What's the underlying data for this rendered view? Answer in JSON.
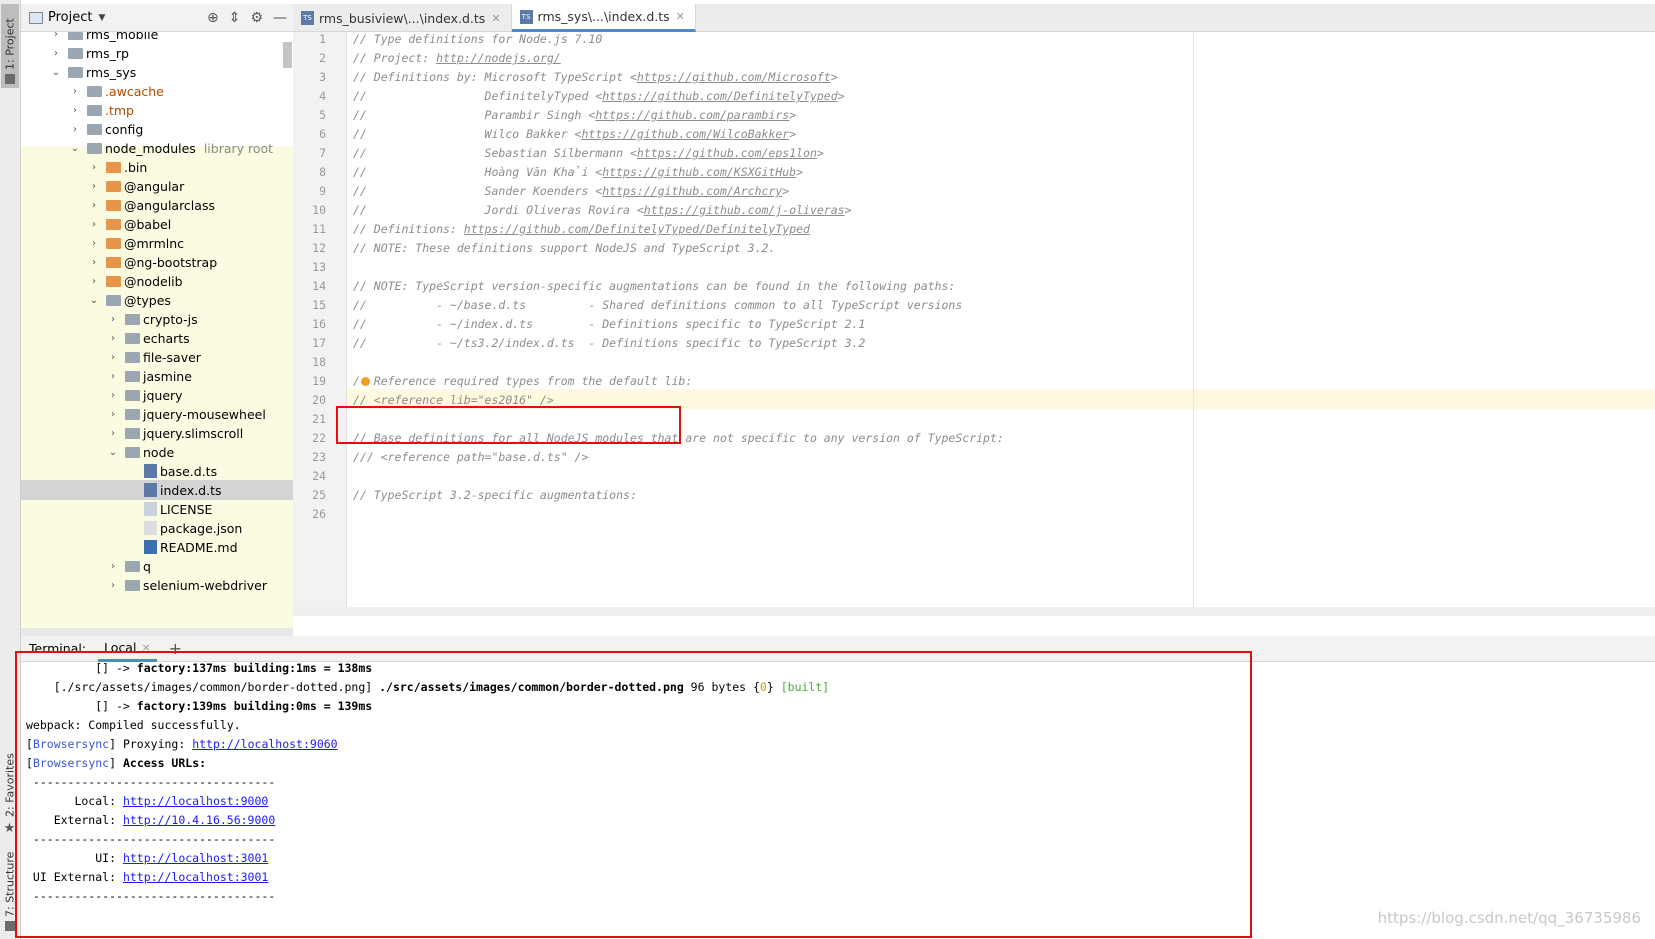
{
  "left_stripe": {
    "project_tab": "1: Project",
    "favorites_tab": "2: Favorites",
    "structure_tab": "7: Structure"
  },
  "project_panel": {
    "title": "Project",
    "tree": [
      {
        "label": "rms_mobile",
        "depth": 1,
        "type": "folder",
        "expanded": false
      },
      {
        "label": "rms_rp",
        "depth": 1,
        "type": "folder",
        "expanded": false
      },
      {
        "label": "rms_sys",
        "depth": 1,
        "type": "folder",
        "expanded": true
      },
      {
        "label": ".awcache",
        "depth": 2,
        "type": "folder",
        "expanded": false,
        "color": "excluded"
      },
      {
        "label": ".tmp",
        "depth": 2,
        "type": "folder",
        "expanded": false,
        "color": "excluded"
      },
      {
        "label": "config",
        "depth": 2,
        "type": "folder",
        "expanded": false
      },
      {
        "label": "node_modules",
        "sub": "library root",
        "depth": 2,
        "type": "folder",
        "expanded": true
      },
      {
        "label": ".bin",
        "depth": 3,
        "type": "folder-orange",
        "expanded": false
      },
      {
        "label": "@angular",
        "depth": 3,
        "type": "folder-orange",
        "expanded": false
      },
      {
        "label": "@angularclass",
        "depth": 3,
        "type": "folder-orange",
        "expanded": false
      },
      {
        "label": "@babel",
        "depth": 3,
        "type": "folder-orange",
        "expanded": false
      },
      {
        "label": "@mrmlnc",
        "depth": 3,
        "type": "folder-orange",
        "expanded": false
      },
      {
        "label": "@ng-bootstrap",
        "depth": 3,
        "type": "folder-orange",
        "expanded": false
      },
      {
        "label": "@nodelib",
        "depth": 3,
        "type": "folder-orange",
        "expanded": false
      },
      {
        "label": "@types",
        "depth": 3,
        "type": "folder",
        "expanded": true
      },
      {
        "label": "crypto-js",
        "depth": 4,
        "type": "folder",
        "expanded": false
      },
      {
        "label": "echarts",
        "depth": 4,
        "type": "folder",
        "expanded": false
      },
      {
        "label": "file-saver",
        "depth": 4,
        "type": "folder",
        "expanded": false
      },
      {
        "label": "jasmine",
        "depth": 4,
        "type": "folder",
        "expanded": false
      },
      {
        "label": "jquery",
        "depth": 4,
        "type": "folder",
        "expanded": false
      },
      {
        "label": "jquery-mousewheel",
        "depth": 4,
        "type": "folder",
        "expanded": false
      },
      {
        "label": "jquery.slimscroll",
        "depth": 4,
        "type": "folder",
        "expanded": false
      },
      {
        "label": "node",
        "depth": 4,
        "type": "folder",
        "expanded": true
      },
      {
        "label": "base.d.ts",
        "depth": 5,
        "type": "ts"
      },
      {
        "label": "index.d.ts",
        "depth": 5,
        "type": "ts",
        "selected": true
      },
      {
        "label": "LICENSE",
        "depth": 5,
        "type": "txt"
      },
      {
        "label": "package.json",
        "depth": 5,
        "type": "json"
      },
      {
        "label": "README.md",
        "depth": 5,
        "type": "md"
      },
      {
        "label": "q",
        "depth": 4,
        "type": "folder",
        "expanded": false
      },
      {
        "label": "selenium-webdriver",
        "depth": 4,
        "type": "folder",
        "expanded": false
      }
    ]
  },
  "editor_tabs": [
    {
      "label": "rms_busiview\\...\\index.d.ts",
      "active": false
    },
    {
      "label": "rms_sys\\...\\index.d.ts",
      "active": true
    }
  ],
  "code_lines": [
    "// Type definitions for Node.js 7.10",
    "// Project: @@http://nodejs.org/",
    "// Definitions by: Microsoft TypeScript <@@https://github.com/Microsoft>",
    "//                 DefinitelyTyped <@@https://github.com/DefinitelyTyped>",
    "//                 Parambir Singh <@@https://github.com/parambirs>",
    "//                 Wilco Bakker <@@https://github.com/WilcoBakker>",
    "//                 Sebastian Silbermann <@@https://github.com/eps1lon>",
    "//                 Hoàng Văn Khải <@@https://github.com/KSXGitHub>",
    "//                 Sander Koenders <@@https://github.com/Archcry>",
    "//                 Jordi Oliveras Rovira <@@https://github.com/j-oliveras>",
    "// Definitions: @@https://github.com/DefinitelyTyped/DefinitelyTyped",
    "// NOTE: These definitions support NodeJS and TypeScript 3.2.",
    "",
    "// NOTE: TypeScript version-specific augmentations can be found in the following paths:",
    "//          - ~/base.d.ts         - Shared definitions common to all TypeScript versions",
    "//          - ~/index.d.ts        - Definitions specific to TypeScript 2.1",
    "//          - ~/ts3.2/index.d.ts  - Definitions specific to TypeScript 3.2",
    "",
    "/  Reference required types from the default lib:",
    "// <reference lib=\"es2016\" />",
    "",
    "// Base definitions for all NodeJS modules that are not specific to any version of TypeScript:",
    "/// <reference path=\"base.d.ts\" />",
    "",
    "// TypeScript 3.2-specific augmentations:",
    ""
  ],
  "terminal": {
    "label": "Terminal:",
    "tab": "Local",
    "lines": [
      {
        "t": "          [] -> factory:137ms building:1ms = 138ms"
      },
      {
        "t": "    [./src/assets/images/common/border-dotted.png] ./src/assets/images/common/border-dotted.png 96 bytes {0} [built]"
      },
      {
        "t": "          [] -> factory:139ms building:0ms = 139ms"
      },
      {
        "t": "webpack: Compiled successfully."
      },
      {
        "t": "[Browsersync] Proxying: http://localhost:9060"
      },
      {
        "t": "[Browsersync] Access URLs:"
      },
      {
        "t": " -----------------------------------"
      },
      {
        "t": "       Local: http://localhost:9000"
      },
      {
        "t": "    External: http://10.4.16.56:9000"
      },
      {
        "t": " -----------------------------------"
      },
      {
        "t": "          UI: http://localhost:3001"
      },
      {
        "t": " UI External: http://localhost:3001"
      },
      {
        "t": " -----------------------------------"
      }
    ]
  },
  "watermark": "https://blog.csdn.net/qq_36735986",
  "colors": {
    "highlight_red": "#e01010",
    "tab_accent": "#4b89d8",
    "library_bg": "#fbfbe2"
  }
}
